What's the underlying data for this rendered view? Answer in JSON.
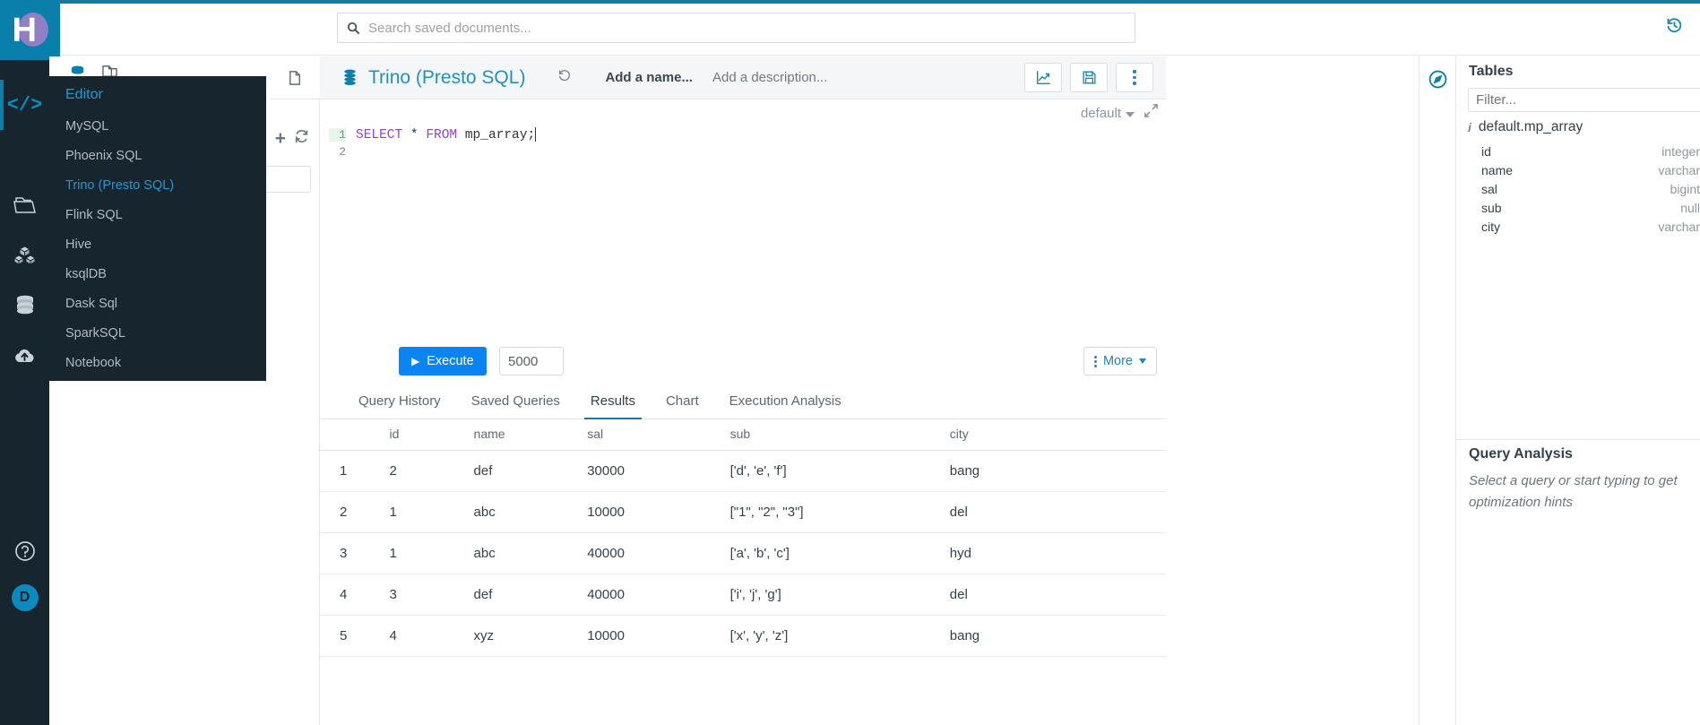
{
  "brand": {
    "logo_letter": "H"
  },
  "topbar": {
    "search_placeholder": "Search saved documents...",
    "search_value": "",
    "history_icon": "history-icon"
  },
  "left_rail": {
    "items": [
      {
        "icon": "code-icon",
        "name": "editor",
        "active": true
      },
      {
        "icon": "folder-open-icon",
        "name": "browser",
        "active": false
      },
      {
        "icon": "cubes-icon",
        "name": "dashboards",
        "active": false
      },
      {
        "icon": "database-icon",
        "name": "tables",
        "active": false
      },
      {
        "icon": "cloud-upload-icon",
        "name": "importer",
        "active": false
      }
    ],
    "help_icon": "question-circle-icon",
    "avatar_letter": "D"
  },
  "flyout": {
    "header": "Editor",
    "items": [
      {
        "label": "MySQL",
        "selected": false
      },
      {
        "label": "Phoenix SQL",
        "selected": false
      },
      {
        "label": "Trino (Presto SQL)",
        "selected": true
      },
      {
        "label": "Flink SQL",
        "selected": false
      },
      {
        "label": "Hive",
        "selected": false
      },
      {
        "label": "ksqlDB",
        "selected": false
      },
      {
        "label": "Dask Sql",
        "selected": false
      },
      {
        "label": "SparkSQL",
        "selected": false
      },
      {
        "label": "Notebook",
        "selected": false
      }
    ]
  },
  "assist": {
    "db_icon": "database-icon",
    "doc_icon": "documents-icon",
    "add_icon": "plus-icon",
    "refresh_icon": "refresh-icon",
    "filter_value": ""
  },
  "editor": {
    "doc_icon": "clipboard-icon",
    "db_icon": "database-stack-icon",
    "title": "Trino (Presto SQL)",
    "history_icon": "history-icon",
    "name_placeholder": "Add a name...",
    "description_placeholder": "Add a description...",
    "buttons": [
      {
        "name": "chart-button",
        "icon": "chart-line-icon"
      },
      {
        "name": "save-button",
        "icon": "floppy-disk-icon"
      },
      {
        "name": "more-options-button",
        "icon": "vertical-dots-icon"
      }
    ],
    "context_database": "default",
    "expand_icon": "expand-arrows-icon",
    "code": {
      "lines": [
        {
          "no": "1",
          "keyword1": "SELECT",
          "star": " * ",
          "keyword2": "FROM",
          "rest": " mp_array;"
        },
        {
          "no": "2",
          "keyword1": "",
          "star": "",
          "keyword2": "",
          "rest": ""
        }
      ],
      "raw": "SELECT * FROM mp_array;"
    }
  },
  "exec": {
    "execute_label": "Execute",
    "play_icon": "play-icon",
    "limit_value": "5000",
    "more_label": "More"
  },
  "tabs": [
    {
      "label": "Query History",
      "active": false
    },
    {
      "label": "Saved Queries",
      "active": false
    },
    {
      "label": "Results",
      "active": true
    },
    {
      "label": "Chart",
      "active": false
    },
    {
      "label": "Execution Analysis",
      "active": false
    }
  ],
  "results": {
    "columns": [
      "",
      "id",
      "name",
      "sal",
      "sub",
      "city"
    ],
    "rows": [
      {
        "idx": "1",
        "id": "2",
        "name": "def",
        "sal": "30000",
        "sub": "['d', 'e', 'f']",
        "city": "bang"
      },
      {
        "idx": "2",
        "id": "1",
        "name": "abc",
        "sal": "10000",
        "sub": "[\"1\", \"2\", \"3\"]",
        "city": "del"
      },
      {
        "idx": "3",
        "id": "1",
        "name": "abc",
        "sal": "40000",
        "sub": "['a', 'b', 'c']",
        "city": "hyd"
      },
      {
        "idx": "4",
        "id": "3",
        "name": "def",
        "sal": "40000",
        "sub": "['i', 'j', 'g']",
        "city": "del"
      },
      {
        "idx": "5",
        "id": "4",
        "name": "xyz",
        "sal": "10000",
        "sub": "['x', 'y', 'z']",
        "city": "bang"
      }
    ]
  },
  "right_rail": {
    "icon": "compass-icon"
  },
  "right_panel": {
    "tables_title": "Tables",
    "filter_placeholder": "Filter...",
    "filter_value": "",
    "table_name": "default.mp_array",
    "info_icon": "info-icon",
    "columns": [
      {
        "name": "id",
        "type": "integer"
      },
      {
        "name": "name",
        "type": "varchar"
      },
      {
        "name": "sal",
        "type": "bigint"
      },
      {
        "name": "sub",
        "type": "null"
      },
      {
        "name": "city",
        "type": "varchar"
      }
    ],
    "query_analysis_title": "Query Analysis",
    "query_analysis_text": "Select a query or start typing to get optimization hints"
  },
  "colors": {
    "brand_blue": "#0b7fab",
    "accent_blue": "#1a7a9e",
    "dark_nav": "#17252e",
    "link_blue": "#2698cf",
    "execute_blue": "#0b84f3",
    "keyword_purple": "#8e44c9"
  }
}
